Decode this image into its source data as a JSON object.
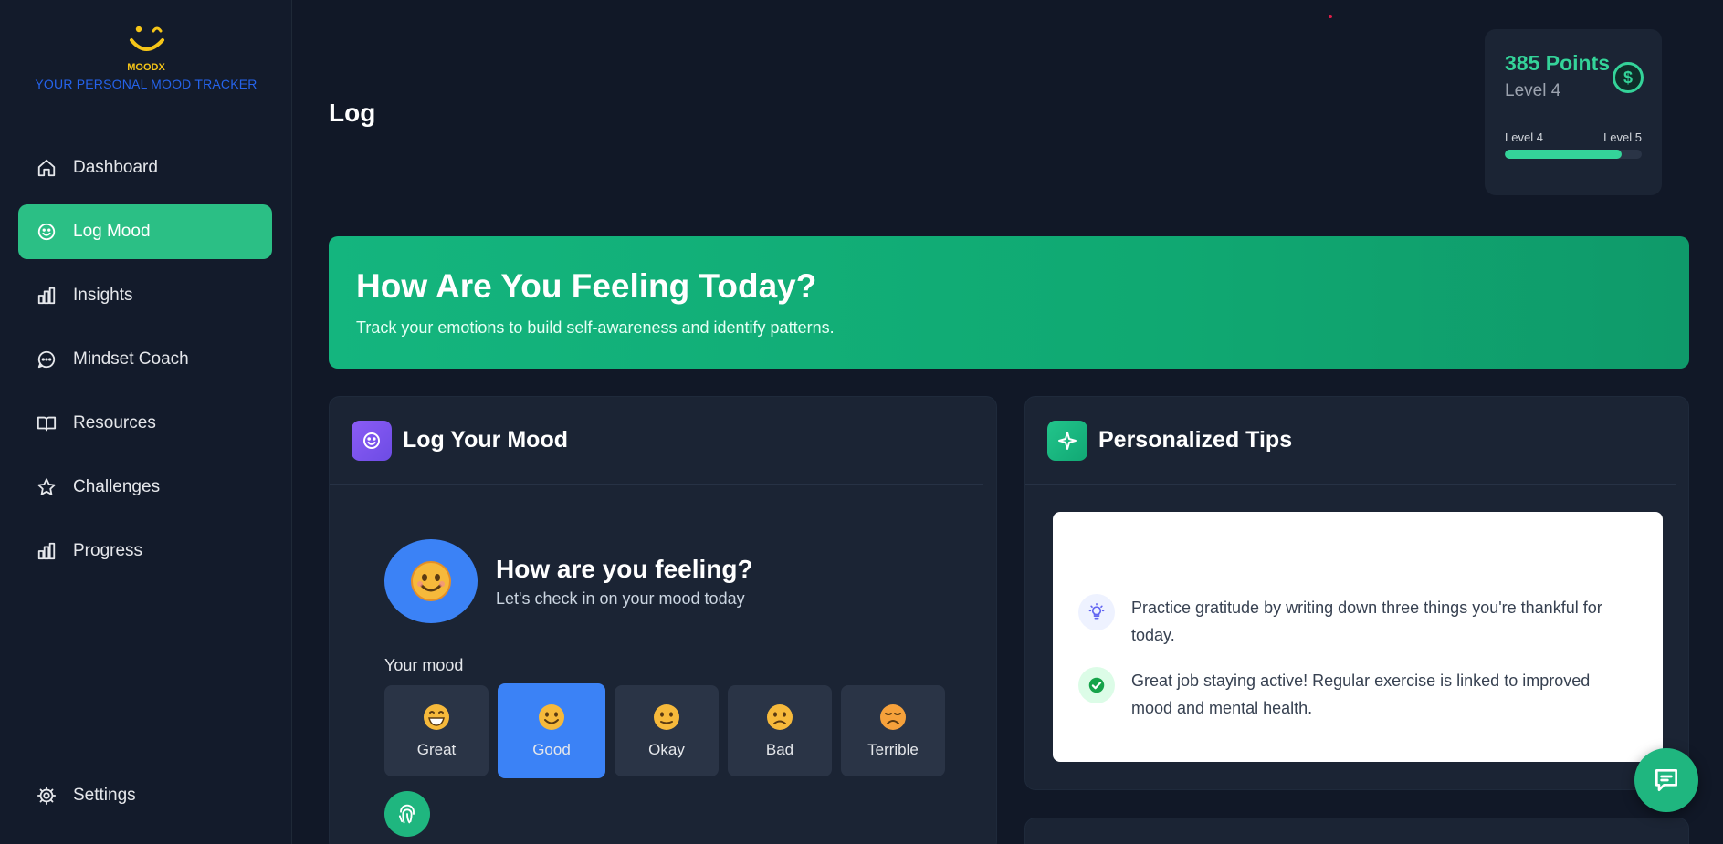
{
  "brand": {
    "name": "MOODX",
    "tagline": "YOUR PERSONAL MOOD TRACKER",
    "colors": {
      "accent": "#2bbf85",
      "points": "#34d399",
      "tagline": "#2563eb"
    }
  },
  "sidebar": {
    "items": [
      {
        "label": "Dashboard",
        "icon": "home-icon"
      },
      {
        "label": "Log Mood",
        "icon": "smile-icon",
        "active": true
      },
      {
        "label": "Insights",
        "icon": "bar-chart-icon"
      },
      {
        "label": "Mindset Coach",
        "icon": "chat-bubble-icon"
      },
      {
        "label": "Resources",
        "icon": "book-icon"
      },
      {
        "label": "Challenges",
        "icon": "star-icon"
      },
      {
        "label": "Progress",
        "icon": "bar-chart-icon"
      }
    ],
    "settings_label": "Settings"
  },
  "header": {
    "title": "Log"
  },
  "points": {
    "value": "385 Points",
    "level": "Level 4",
    "from_level": "Level 4",
    "to_level": "Level 5",
    "progress_pct": 85
  },
  "hero": {
    "title": "How Are You Feeling Today?",
    "subtitle": "Track your emotions to build self-awareness and identify patterns."
  },
  "log_card": {
    "title": "Log Your Mood",
    "feeling_title": "How are you feeling?",
    "feeling_subtitle": "Let's check in on your mood today",
    "mood_label": "Your mood",
    "moods": [
      {
        "label": "Great",
        "icon": "grinning-face-icon"
      },
      {
        "label": "Good",
        "icon": "smiling-face-icon",
        "selected": true
      },
      {
        "label": "Okay",
        "icon": "neutral-face-icon"
      },
      {
        "label": "Bad",
        "icon": "frowning-face-icon"
      },
      {
        "label": "Terrible",
        "icon": "sad-face-icon"
      }
    ]
  },
  "tips_card": {
    "title": "Personalized Tips",
    "tips": [
      {
        "text": "Practice gratitude by writing down three things you're thankful for today.",
        "icon": "lightbulb-icon"
      },
      {
        "text": "Great job staying active! Regular exercise is linked to improved mood and mental health.",
        "icon": "check-circle-icon"
      }
    ]
  }
}
